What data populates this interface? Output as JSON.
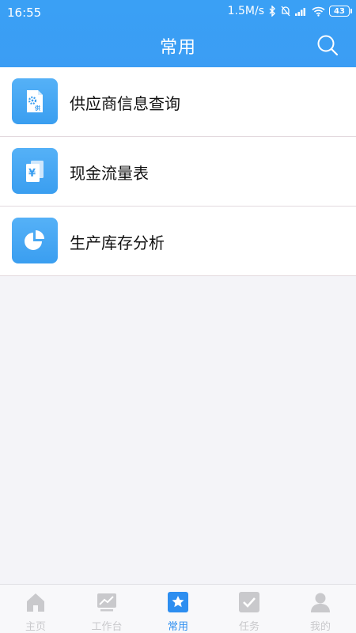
{
  "status": {
    "time": "16:55",
    "speed": "1.5M/s",
    "battery": "43"
  },
  "header": {
    "title": "常用"
  },
  "items": [
    {
      "label": "供应商信息查询",
      "icon": "supplier-doc-icon"
    },
    {
      "label": "现金流量表",
      "icon": "cash-flow-icon"
    },
    {
      "label": "生产库存分析",
      "icon": "pie-chart-icon"
    }
  ],
  "tabs": [
    {
      "label": "主页",
      "icon": "home-icon"
    },
    {
      "label": "工作台",
      "icon": "workbench-icon"
    },
    {
      "label": "常用",
      "icon": "star-icon",
      "active": true
    },
    {
      "label": "任务",
      "icon": "task-check-icon"
    },
    {
      "label": "我的",
      "icon": "user-icon"
    }
  ],
  "colors": {
    "primary": "#3b9df4",
    "active_tab": "#2d8ef0",
    "inactive_tab": "#c9c9cc"
  }
}
